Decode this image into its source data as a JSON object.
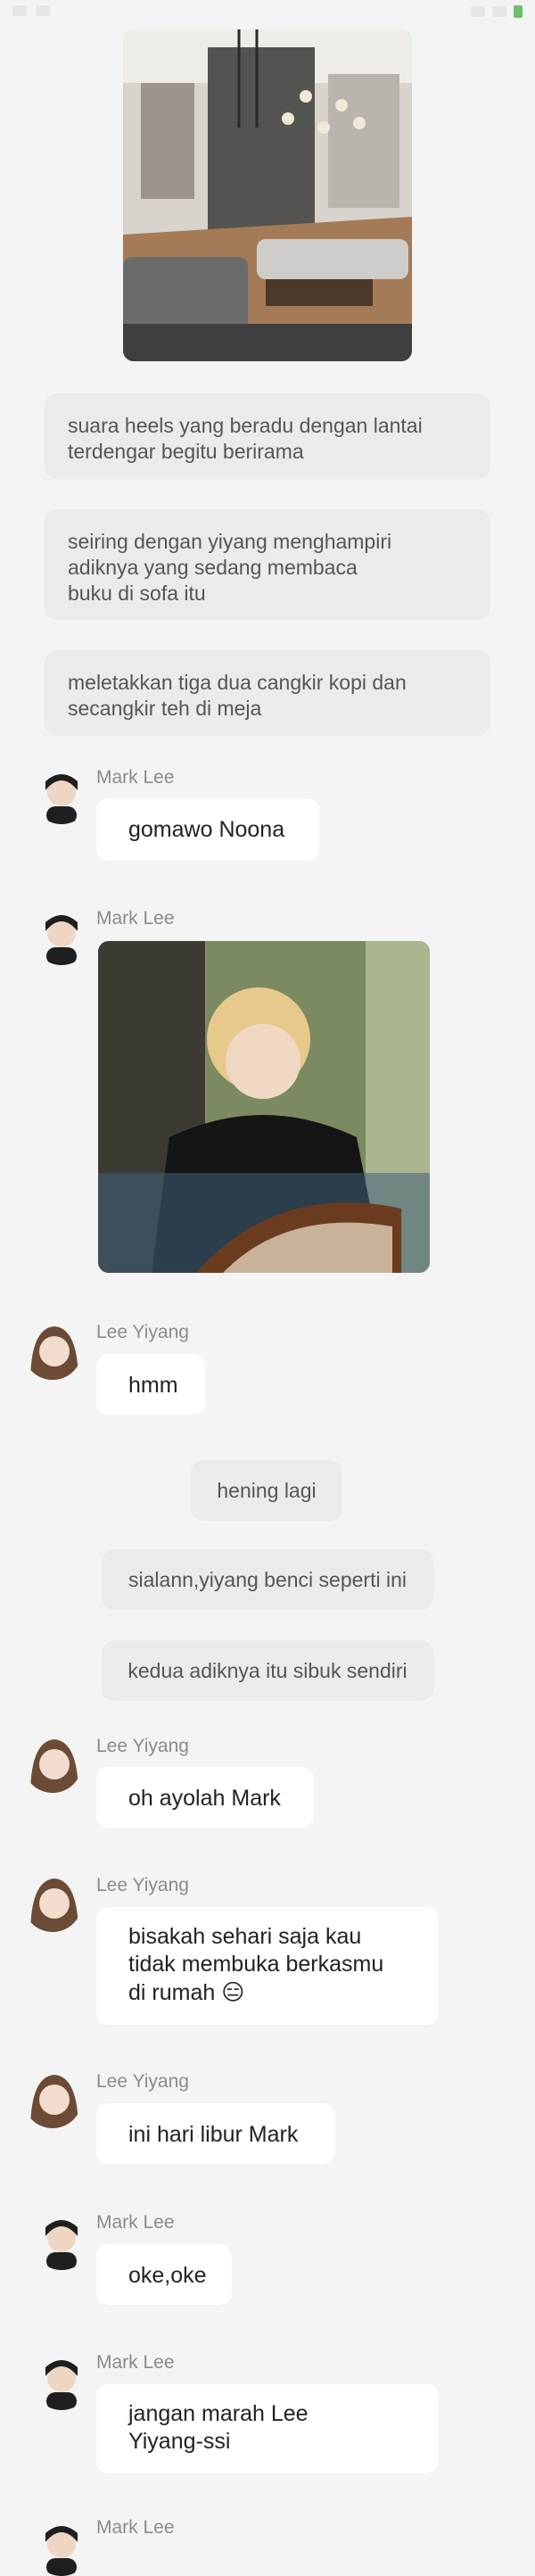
{
  "narrations": [
    {
      "lines": [
        "suara heels yang beradu dengan lantai",
        "terdengar begitu berirama"
      ]
    },
    {
      "lines": [
        "seiring dengan yiyang menghampiri",
        "adiknya yang sedang membaca",
        "buku di sofa itu"
      ]
    },
    {
      "lines": [
        "meletakkan tiga dua cangkir kopi dan",
        "secangkir teh di meja"
      ]
    }
  ],
  "pills": [
    {
      "text": "hening lagi"
    },
    {
      "text": "sialann,yiyang benci seperti ini"
    },
    {
      "text": "kedua adiknya itu sibuk sendiri"
    }
  ],
  "messages": [
    {
      "sender": "Mark Lee",
      "lines": [
        "gomawo Noona"
      ]
    },
    {
      "sender": "Mark Lee",
      "lines": []
    },
    {
      "sender": "Lee Yiyang",
      "lines": [
        "hmm"
      ]
    },
    {
      "sender": "Lee Yiyang",
      "lines": [
        "oh ayolah Mark"
      ]
    },
    {
      "sender": "Lee Yiyang",
      "lines": [
        "bisakah sehari saja kau",
        "tidak membuka berkasmu",
        "di rumah 😑"
      ]
    },
    {
      "sender": "Lee Yiyang",
      "lines": [
        "ini hari libur Mark"
      ]
    },
    {
      "sender": "Mark Lee",
      "lines": [
        "oke,oke"
      ]
    },
    {
      "sender": "Mark Lee",
      "lines": [
        "jangan marah Lee",
        "Yiyang-ssi"
      ]
    },
    {
      "sender": "Mark Lee",
      "lines": []
    }
  ],
  "colors": {
    "background": "#f4f4f4",
    "narration_bubble": "#ebebeb",
    "chat_bubble": "#ffffff",
    "sender_name": "#8a8a8a"
  },
  "icons": {
    "status_bar": [
      "notification-icon",
      "twitter-icon",
      "signal-icon",
      "wifi-icon",
      "battery-icon"
    ]
  }
}
